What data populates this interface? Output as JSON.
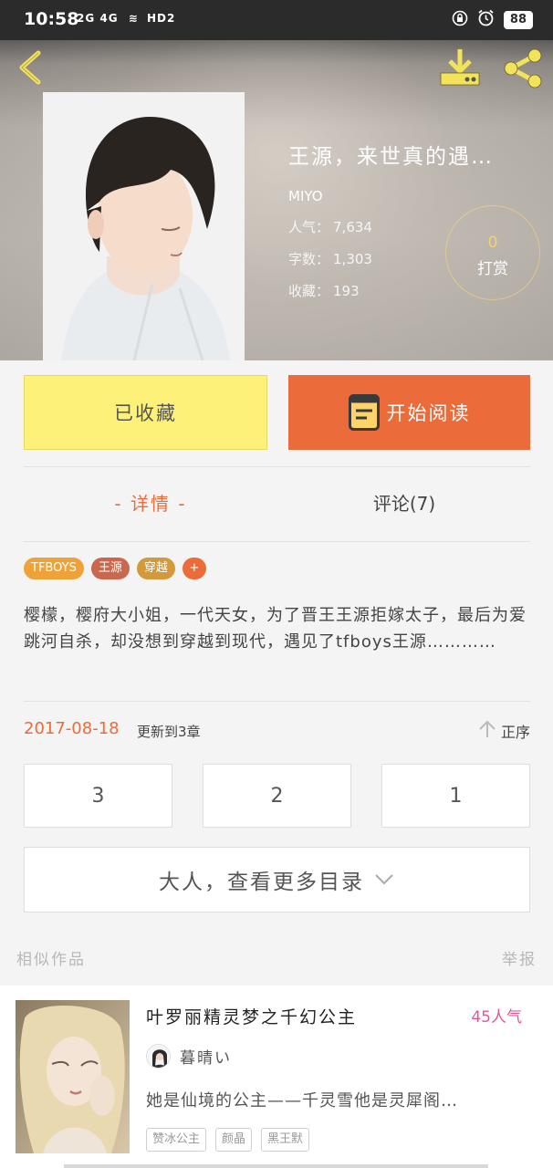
{
  "status_bar": {
    "time": "10:58",
    "signal": "2G 4G",
    "network": "HD2",
    "battery": "88"
  },
  "book": {
    "title": "王源，来世真的遇…",
    "author": "MIYO",
    "stats": [
      {
        "label": "人气：",
        "value": "7,634"
      },
      {
        "label": "字数：",
        "value": "1,303"
      },
      {
        "label": "收藏：",
        "value": "193"
      }
    ],
    "tip_count": "0",
    "tip_label": "打赏"
  },
  "actions": {
    "collect_label": "已收藏",
    "read_label": "开始阅读"
  },
  "tabs": {
    "detail": "- 详情 -",
    "comments": "评论(7)"
  },
  "tags": [
    {
      "label": "TFBOYS",
      "color": "#f0a23a"
    },
    {
      "label": "王源",
      "color": "#c9684e"
    },
    {
      "label": "穿越",
      "color": "#d29a3a"
    }
  ],
  "tag_add": "+",
  "synopsis": "樱檬，樱府大小姐，一代天女，为了晋王王源拒嫁太子，最后为爱跳河自杀，却没想到穿越到现代，遇见了tfboys王源…………",
  "update": {
    "date": "2017-08-18",
    "text": "更新到3章",
    "order_label": "正序"
  },
  "chapters": [
    "3",
    "2",
    "1"
  ],
  "more_toc": "大人，查看更多目录",
  "similar": {
    "section_label": "相似作品",
    "report_label": "举报",
    "item": {
      "title": "叶罗丽精灵梦之千幻公主",
      "popularity": "45人气",
      "author": "暮晴い",
      "description": "她是仙境的公主——千灵雪他是灵犀阁…",
      "tags": [
        "赞冰公主",
        "颜晶",
        "黑王默"
      ]
    }
  },
  "colors": {
    "accent": "#ec6b3b",
    "collect_bg": "#fef17a",
    "popularity": "#e0589a"
  }
}
